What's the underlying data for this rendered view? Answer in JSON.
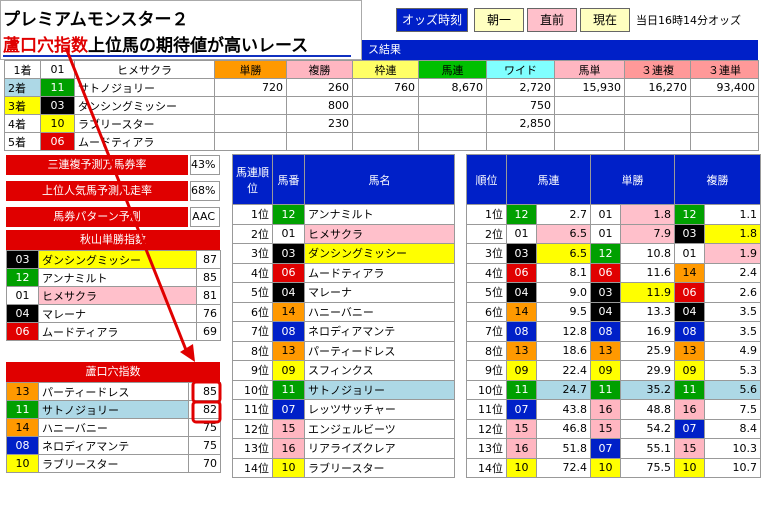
{
  "title": {
    "line1": "プレミアムモンスター２",
    "line2_red": "蘆口穴指数",
    "line2_rest": "上位馬の期待値が高いレース"
  },
  "buttons": {
    "odds_time": "オッズ時刻",
    "asaichi": "朝一",
    "chokuzen": "直前",
    "genzai": "現在",
    "now_odds": "当日16時14分オッズ"
  },
  "result_header": "ス結果",
  "result_cols": [
    "単勝",
    "複勝",
    "枠連",
    "馬連",
    "ワイド",
    "馬単",
    "３連複",
    "３連単"
  ],
  "results": [
    {
      "rank": "1着",
      "num": "01",
      "name": "ヒメサクラ",
      "vals": [
        "720",
        "260",
        "760",
        "8,670",
        "2,720",
        "15,930",
        "16,270",
        "93,400"
      ]
    },
    {
      "rank": "2着",
      "num": "11",
      "name": "サトノジョリー",
      "vals": [
        "",
        "800",
        "",
        "",
        "750",
        "",
        "",
        ""
      ]
    },
    {
      "rank": "3着",
      "num": "03",
      "name": "ダンシングミッシー",
      "vals": [
        "",
        "230",
        "",
        "",
        "2,850",
        "",
        "",
        ""
      ]
    },
    {
      "rank": "4着",
      "num": "10",
      "name": "ラブリースター",
      "vals": [
        "",
        "",
        "",
        "",
        "",
        "",
        "",
        ""
      ]
    },
    {
      "rank": "5着",
      "num": "06",
      "name": "ムードティアラ",
      "vals": [
        "",
        "",
        "",
        "",
        "",
        "",
        "",
        ""
      ]
    }
  ],
  "stats": [
    {
      "label": "三連複予測万馬券率",
      "value": "43%"
    },
    {
      "label": "上位人気馬予測凡走率",
      "value": "68%"
    },
    {
      "label": "馬券パターン予測",
      "value": "AAC"
    }
  ],
  "akiyama": {
    "title": "秋山単勝指数",
    "rows": [
      {
        "num": "03",
        "name": "ダンシングミッシー",
        "val": "87"
      },
      {
        "num": "12",
        "name": "アンナミルト",
        "val": "85"
      },
      {
        "num": "01",
        "name": "ヒメサクラ",
        "val": "81"
      },
      {
        "num": "04",
        "name": "マレーナ",
        "val": "76"
      },
      {
        "num": "06",
        "name": "ムードティアラ",
        "val": "69"
      }
    ]
  },
  "roguchi": {
    "title": "蘆口穴指数",
    "rows": [
      {
        "num": "13",
        "name": "パーティードレス",
        "val": "85"
      },
      {
        "num": "11",
        "name": "サトノジョリー",
        "val": "82"
      },
      {
        "num": "14",
        "name": "ハニーバニー",
        "val": "75"
      },
      {
        "num": "08",
        "name": "ネロディアマンテ",
        "val": "75"
      },
      {
        "num": "10",
        "name": "ラブリースター",
        "val": "70"
      }
    ]
  },
  "umaren_rank": {
    "h_rank": "馬連順位",
    "h_num": "馬番",
    "h_name": "馬名",
    "rows": [
      {
        "rank": "1位",
        "num": "12",
        "name": "アンナミルト"
      },
      {
        "rank": "2位",
        "num": "01",
        "name": "ヒメサクラ"
      },
      {
        "rank": "3位",
        "num": "03",
        "name": "ダンシングミッシー"
      },
      {
        "rank": "4位",
        "num": "06",
        "name": "ムードティアラ"
      },
      {
        "rank": "5位",
        "num": "04",
        "name": "マレーナ"
      },
      {
        "rank": "6位",
        "num": "14",
        "name": "ハニーバニー"
      },
      {
        "rank": "7位",
        "num": "08",
        "name": "ネロディアマンテ"
      },
      {
        "rank": "8位",
        "num": "13",
        "name": "パーティードレス"
      },
      {
        "rank": "9位",
        "num": "09",
        "name": "スフィンクス"
      },
      {
        "rank": "10位",
        "num": "11",
        "name": "サトノジョリー"
      },
      {
        "rank": "11位",
        "num": "07",
        "name": "レッツサッチャー"
      },
      {
        "rank": "12位",
        "num": "15",
        "name": "エンジェルビーツ"
      },
      {
        "rank": "13位",
        "num": "16",
        "name": "リアライズクレア"
      },
      {
        "rank": "14位",
        "num": "10",
        "name": "ラブリースター"
      }
    ]
  },
  "odds_rank": {
    "h_rank": "順位",
    "h_umaren": "馬連",
    "h_tansho": "単勝",
    "h_fukusho": "複勝",
    "rows": [
      {
        "rank": "1位",
        "u": [
          "12",
          "2.7"
        ],
        "t": [
          "01",
          "1.8"
        ],
        "f": [
          "12",
          "1.1"
        ]
      },
      {
        "rank": "2位",
        "u": [
          "01",
          "6.5"
        ],
        "t": [
          "01",
          "7.9"
        ],
        "f": [
          "03",
          "1.8"
        ]
      },
      {
        "rank": "3位",
        "u": [
          "03",
          "6.5"
        ],
        "t": [
          "12",
          "10.8"
        ],
        "f": [
          "01",
          "1.9"
        ]
      },
      {
        "rank": "4位",
        "u": [
          "06",
          "8.1"
        ],
        "t": [
          "06",
          "11.6"
        ],
        "f": [
          "14",
          "2.4"
        ]
      },
      {
        "rank": "5位",
        "u": [
          "04",
          "9.0"
        ],
        "t": [
          "03",
          "11.9"
        ],
        "f": [
          "06",
          "2.6"
        ]
      },
      {
        "rank": "6位",
        "u": [
          "14",
          "9.5"
        ],
        "t": [
          "04",
          "13.3"
        ],
        "f": [
          "04",
          "3.5"
        ]
      },
      {
        "rank": "7位",
        "u": [
          "08",
          "12.8"
        ],
        "t": [
          "08",
          "16.9"
        ],
        "f": [
          "08",
          "3.5"
        ]
      },
      {
        "rank": "8位",
        "u": [
          "13",
          "18.6"
        ],
        "t": [
          "13",
          "25.9"
        ],
        "f": [
          "13",
          "4.9"
        ]
      },
      {
        "rank": "9位",
        "u": [
          "09",
          "22.4"
        ],
        "t": [
          "09",
          "29.9"
        ],
        "f": [
          "09",
          "5.3"
        ]
      },
      {
        "rank": "10位",
        "u": [
          "11",
          "24.7"
        ],
        "t": [
          "11",
          "35.2"
        ],
        "f": [
          "11",
          "5.6"
        ]
      },
      {
        "rank": "11位",
        "u": [
          "07",
          "43.8"
        ],
        "t": [
          "16",
          "48.8"
        ],
        "f": [
          "16",
          "7.5"
        ]
      },
      {
        "rank": "12位",
        "u": [
          "15",
          "46.8"
        ],
        "t": [
          "15",
          "54.2"
        ],
        "f": [
          "07",
          "8.4"
        ]
      },
      {
        "rank": "13位",
        "u": [
          "16",
          "51.8"
        ],
        "t": [
          "07",
          "55.1"
        ],
        "f": [
          "15",
          "10.3"
        ]
      },
      {
        "rank": "14位",
        "u": [
          "10",
          "72.4"
        ],
        "t": [
          "10",
          "75.5"
        ],
        "f": [
          "10",
          "10.7"
        ]
      }
    ]
  }
}
